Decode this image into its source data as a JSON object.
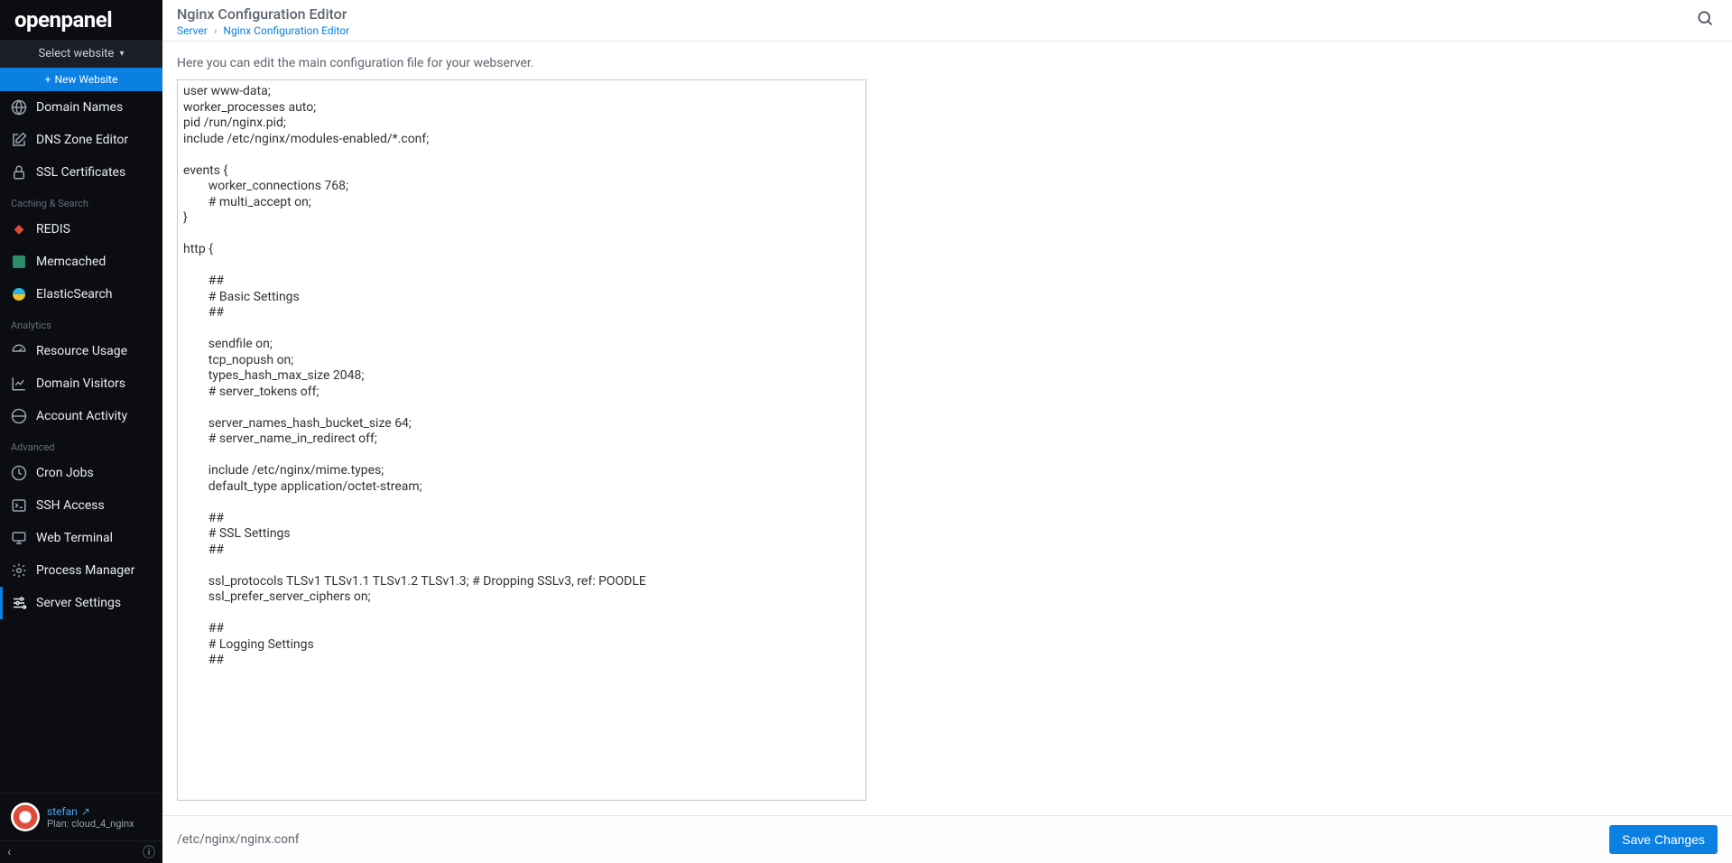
{
  "brand": "openpanel",
  "website_selector": {
    "label": "Select website"
  },
  "new_website_label": "New Website",
  "sidebar": {
    "visible_items": [
      {
        "label": "Domain Names",
        "icon": "globe-icon"
      },
      {
        "label": "DNS Zone Editor",
        "icon": "edit-icon"
      },
      {
        "label": "SSL Certificates",
        "icon": "lock-icon"
      }
    ],
    "sections": [
      {
        "title": "Caching & Search",
        "items": [
          {
            "label": "REDIS",
            "icon": "redis-icon"
          },
          {
            "label": "Memcached",
            "icon": "memcached-icon"
          },
          {
            "label": "ElasticSearch",
            "icon": "elasticsearch-icon"
          }
        ]
      },
      {
        "title": "Analytics",
        "items": [
          {
            "label": "Resource Usage",
            "icon": "gauge-icon"
          },
          {
            "label": "Domain Visitors",
            "icon": "chart-icon"
          },
          {
            "label": "Account Activity",
            "icon": "world-icon"
          }
        ]
      },
      {
        "title": "Advanced",
        "items": [
          {
            "label": "Cron Jobs",
            "icon": "clock-icon"
          },
          {
            "label": "SSH Access",
            "icon": "terminal-icon"
          },
          {
            "label": "Web Terminal",
            "icon": "monitor-icon"
          },
          {
            "label": "Process Manager",
            "icon": "gear-icon"
          },
          {
            "label": "Server Settings",
            "icon": "sliders-icon",
            "active": true
          }
        ]
      }
    ]
  },
  "user": {
    "name": "stefan",
    "plan": "Plan: cloud_4_nginx"
  },
  "header": {
    "title": "Nginx Configuration Editor",
    "breadcrumb_root": "Server",
    "breadcrumb_current": "Nginx Configuration Editor"
  },
  "intro_text": "Here you can edit the main configuration file for your webserver.",
  "editor_value": "user www-data;\nworker_processes auto;\npid /run/nginx.pid;\ninclude /etc/nginx/modules-enabled/*.conf;\n\nevents {\n        worker_connections 768;\n        # multi_accept on;\n}\n\nhttp {\n\n        ##\n        # Basic Settings\n        ##\n\n        sendfile on;\n        tcp_nopush on;\n        types_hash_max_size 2048;\n        # server_tokens off;\n\n        server_names_hash_bucket_size 64;\n        # server_name_in_redirect off;\n\n        include /etc/nginx/mime.types;\n        default_type application/octet-stream;\n\n        ##\n        # SSL Settings\n        ##\n\n        ssl_protocols TLSv1 TLSv1.1 TLSv1.2 TLSv1.3; # Dropping SSLv3, ref: POODLE\n        ssl_prefer_server_ciphers on;\n\n        ##\n        # Logging Settings\n        ##\n",
  "file_path": "/etc/nginx/nginx.conf",
  "save_label": "Save Changes"
}
